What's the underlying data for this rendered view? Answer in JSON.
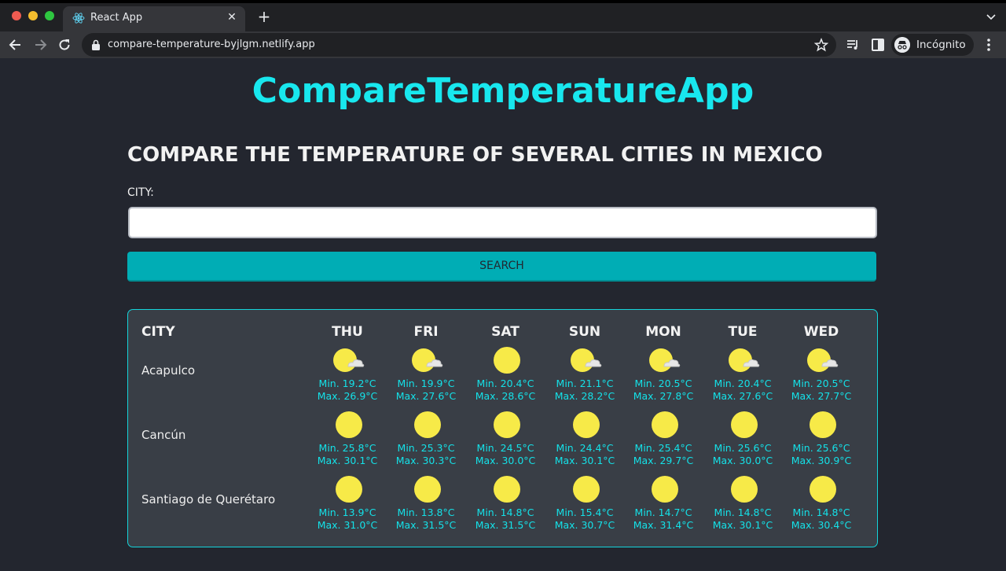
{
  "browser": {
    "tab_title": "React App",
    "url": "compare-temperature-byjlgm.netlify.app",
    "profile_label": "Incógnito"
  },
  "page": {
    "app_title": "CompareTemperatureApp",
    "subtitle": "COMPARE THE TEMPERATURE OF SEVERAL CITIES IN MEXICO",
    "city_label": "CITY:",
    "city_input_value": "",
    "search_label": "SEARCH"
  },
  "table": {
    "city_header": "CITY",
    "days": [
      "THU",
      "FRI",
      "SAT",
      "SUN",
      "MON",
      "TUE",
      "WED"
    ],
    "rows": [
      {
        "city": "Acapulco",
        "forecast": [
          {
            "icon": "sun-cloud-icon",
            "min": "Min. 19.2°C",
            "max": "Max. 26.9°C"
          },
          {
            "icon": "sun-cloud-icon",
            "min": "Min. 19.9°C",
            "max": "Max. 27.6°C"
          },
          {
            "icon": "sun-icon",
            "min": "Min. 20.4°C",
            "max": "Max. 28.6°C"
          },
          {
            "icon": "sun-cloud-icon",
            "min": "Min. 21.1°C",
            "max": "Max. 28.2°C"
          },
          {
            "icon": "sun-cloud-icon",
            "min": "Min. 20.5°C",
            "max": "Max. 27.8°C"
          },
          {
            "icon": "sun-cloud-icon",
            "min": "Min. 20.4°C",
            "max": "Max. 27.6°C"
          },
          {
            "icon": "sun-cloud-icon",
            "min": "Min. 20.5°C",
            "max": "Max. 27.7°C"
          }
        ]
      },
      {
        "city": "Cancún",
        "forecast": [
          {
            "icon": "sun-icon",
            "min": "Min. 25.8°C",
            "max": "Max. 30.1°C"
          },
          {
            "icon": "sun-icon",
            "min": "Min. 25.3°C",
            "max": "Max. 30.3°C"
          },
          {
            "icon": "sun-icon",
            "min": "Min. 24.5°C",
            "max": "Max. 30.0°C"
          },
          {
            "icon": "sun-icon",
            "min": "Min. 24.4°C",
            "max": "Max. 30.1°C"
          },
          {
            "icon": "sun-icon",
            "min": "Min. 25.4°C",
            "max": "Max. 29.7°C"
          },
          {
            "icon": "sun-icon",
            "min": "Min. 25.6°C",
            "max": "Max. 30.0°C"
          },
          {
            "icon": "sun-icon",
            "min": "Min. 25.6°C",
            "max": "Max. 30.9°C"
          }
        ]
      },
      {
        "city": "Santiago de Querétaro",
        "forecast": [
          {
            "icon": "sun-icon",
            "min": "Min. 13.9°C",
            "max": "Max. 31.0°C"
          },
          {
            "icon": "sun-icon",
            "min": "Min. 13.8°C",
            "max": "Max. 31.5°C"
          },
          {
            "icon": "sun-icon",
            "min": "Min. 14.8°C",
            "max": "Max. 31.5°C"
          },
          {
            "icon": "sun-icon",
            "min": "Min. 15.4°C",
            "max": "Max. 30.7°C"
          },
          {
            "icon": "sun-icon",
            "min": "Min. 14.7°C",
            "max": "Max. 31.4°C"
          },
          {
            "icon": "sun-icon",
            "min": "Min. 14.8°C",
            "max": "Max. 30.1°C"
          },
          {
            "icon": "sun-icon",
            "min": "Min. 14.8°C",
            "max": "Max. 30.4°C"
          }
        ]
      }
    ]
  },
  "colors": {
    "background": "#23262f",
    "accent": "#18e7ee",
    "button": "#00adb5",
    "panel": "#393e46",
    "sun": "#f7ea48"
  }
}
